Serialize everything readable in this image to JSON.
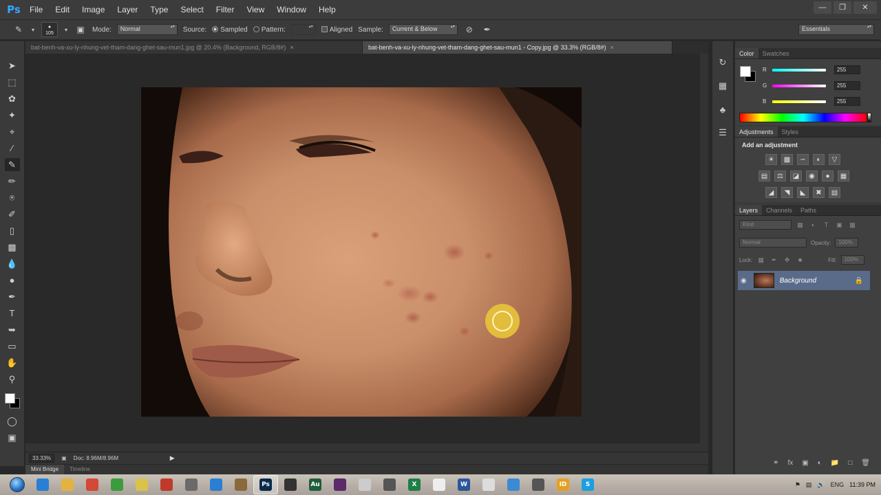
{
  "app": {
    "logo": "Ps"
  },
  "menu": [
    "File",
    "Edit",
    "Image",
    "Layer",
    "Type",
    "Select",
    "Filter",
    "View",
    "Window",
    "Help"
  ],
  "options": {
    "brush_size": "105",
    "mode_label": "Mode:",
    "mode_value": "Normal",
    "source_label": "Source:",
    "sampled_label": "Sampled",
    "pattern_label": "Pattern:",
    "aligned_label": "Aligned",
    "sample_label": "Sample:",
    "sample_value": "Current & Below",
    "workspace": "Essentials"
  },
  "documents": {
    "tabs": [
      {
        "label": "bat-benh-va-xu-ly-nhung-vet-tham-dang-ghet-sau-mun1.jpg @ 20.4% (Background, RGB/8#)",
        "active": false
      },
      {
        "label": "bat-benh-va-xu-ly-nhung-vet-tham-dang-ghet-sau-mun1 - Copy.jpg @ 33.3% (RGB/8#)",
        "active": true
      }
    ],
    "close_glyph": "×"
  },
  "status": {
    "zoom": "33.33%",
    "doc_info": "Doc: 8.96M/8.96M"
  },
  "bottom_tabs": [
    "Mini Bridge",
    "Timeline"
  ],
  "color_panel": {
    "tabs": [
      "Color",
      "Swatches"
    ],
    "channels": [
      {
        "letter": "R",
        "value": "255",
        "gradient": "#00ffff"
      },
      {
        "letter": "G",
        "value": "255",
        "gradient": "#ff00ff"
      },
      {
        "letter": "B",
        "value": "255",
        "gradient": "#ffff00"
      }
    ]
  },
  "adjustments": {
    "tabs": [
      "Adjustments",
      "Styles"
    ],
    "title": "Add an adjustment"
  },
  "layers": {
    "tabs": [
      "Layers",
      "Channels",
      "Paths"
    ],
    "kind": "Kind",
    "blend_mode": "Normal",
    "opacity_label": "Opacity:",
    "opacity_value": "100%",
    "lock_label": "Lock:",
    "fill_label": "Fill:",
    "fill_value": "100%",
    "items": [
      {
        "name": "Background"
      }
    ]
  },
  "taskbar": {
    "language": "ENG",
    "time": "11:39 PM",
    "apps": [
      {
        "name": "ie",
        "color": "#2a7fd4"
      },
      {
        "name": "explorer",
        "color": "#e3b341"
      },
      {
        "name": "chrome",
        "color": "#d34836"
      },
      {
        "name": "app-green",
        "color": "#3c9b3c"
      },
      {
        "name": "notepad",
        "color": "#d9c24a"
      },
      {
        "name": "app-red",
        "color": "#c03a2b"
      },
      {
        "name": "app-grid",
        "color": "#6a6a6a"
      },
      {
        "name": "app-blue",
        "color": "#2a7fd4"
      },
      {
        "name": "app-tools",
        "color": "#8a6a3a"
      },
      {
        "name": "photoshop",
        "color": "#0a2a4a",
        "label": "Ps",
        "active": true
      },
      {
        "name": "app-dark",
        "color": "#333"
      },
      {
        "name": "audition",
        "color": "#1e5e3a",
        "label": "Au"
      },
      {
        "name": "premiere",
        "color": "#5a2a6a"
      },
      {
        "name": "app-light",
        "color": "#ccc"
      },
      {
        "name": "camtasia",
        "color": "#555"
      },
      {
        "name": "excel",
        "color": "#1e7e45",
        "label": "X"
      },
      {
        "name": "app-white",
        "color": "#eee"
      },
      {
        "name": "word",
        "color": "#2b579a",
        "label": "W"
      },
      {
        "name": "app-doc",
        "color": "#ddd"
      },
      {
        "name": "app-globe",
        "color": "#3a8ad4"
      },
      {
        "name": "app-x",
        "color": "#555"
      },
      {
        "name": "app-yellow",
        "color": "#e3a020",
        "label": "ID"
      },
      {
        "name": "skype",
        "color": "#1a9fe0",
        "label": "S"
      }
    ]
  }
}
